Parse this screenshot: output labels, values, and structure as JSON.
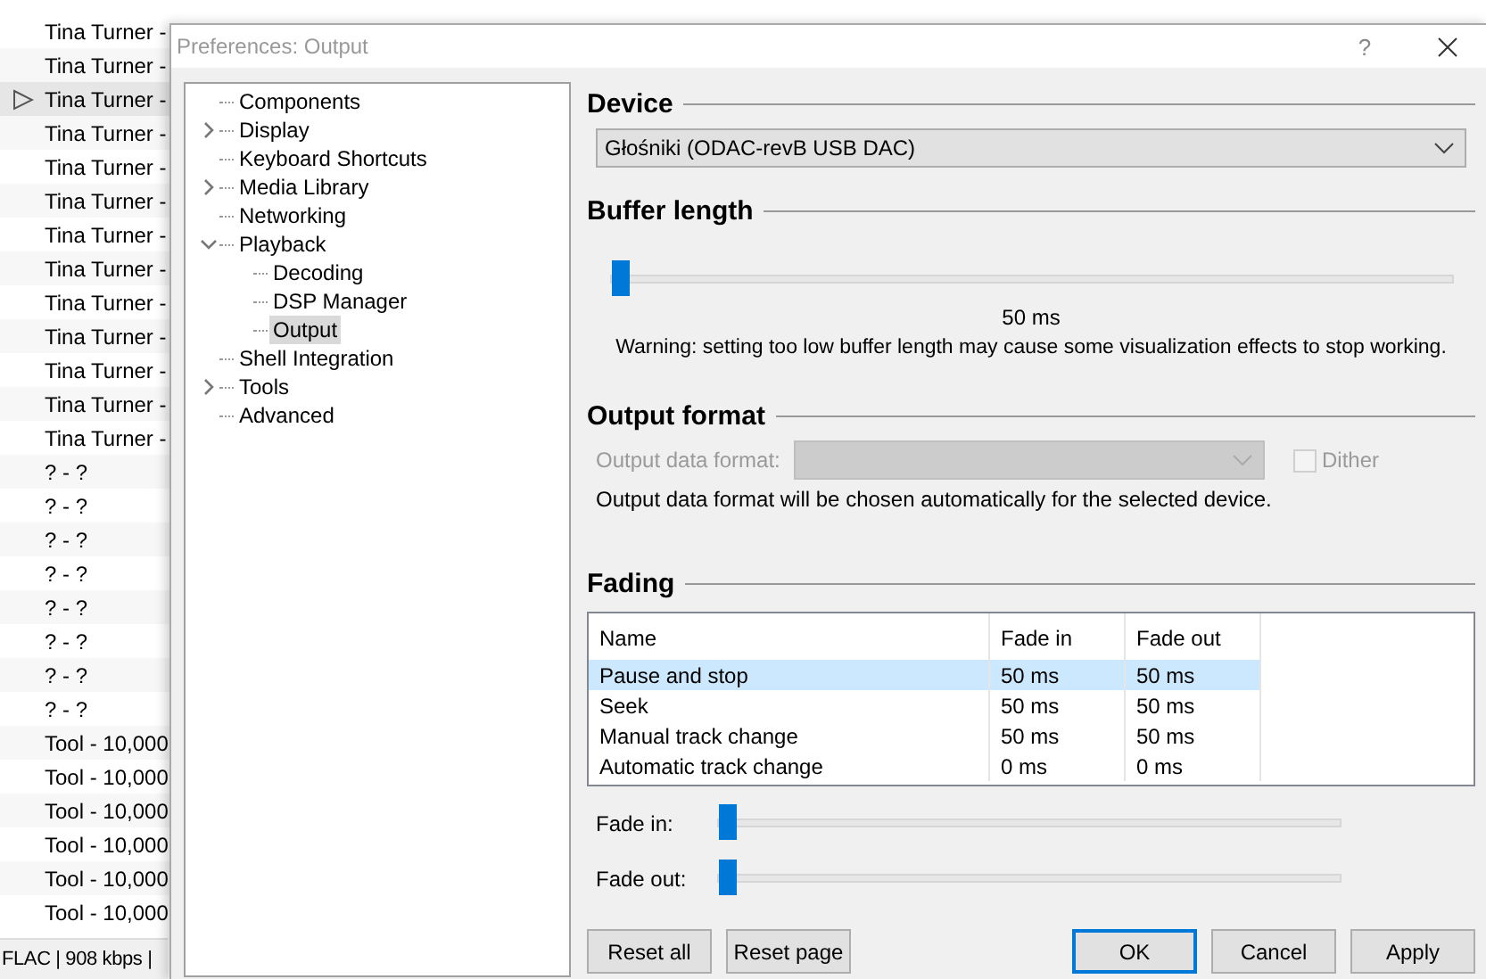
{
  "playlist": {
    "rows": [
      {
        "text": "Tina Turner -",
        "playing": false,
        "selected": false
      },
      {
        "text": "Tina Turner -",
        "playing": false,
        "selected": false
      },
      {
        "text": "Tina Turner -",
        "playing": true,
        "selected": true
      },
      {
        "text": "Tina Turner -",
        "playing": false,
        "selected": false
      },
      {
        "text": "Tina Turner -",
        "playing": false,
        "selected": false
      },
      {
        "text": "Tina Turner -",
        "playing": false,
        "selected": false
      },
      {
        "text": "Tina Turner -",
        "playing": false,
        "selected": false
      },
      {
        "text": "Tina Turner -",
        "playing": false,
        "selected": false
      },
      {
        "text": "Tina Turner -",
        "playing": false,
        "selected": false
      },
      {
        "text": "Tina Turner -",
        "playing": false,
        "selected": false
      },
      {
        "text": "Tina Turner -",
        "playing": false,
        "selected": false
      },
      {
        "text": "Tina Turner -",
        "playing": false,
        "selected": false
      },
      {
        "text": "Tina Turner -",
        "playing": false,
        "selected": false
      },
      {
        "text": "? - ?",
        "playing": false,
        "selected": false
      },
      {
        "text": "? - ?",
        "playing": false,
        "selected": false
      },
      {
        "text": "? - ?",
        "playing": false,
        "selected": false
      },
      {
        "text": "? - ?",
        "playing": false,
        "selected": false
      },
      {
        "text": "? - ?",
        "playing": false,
        "selected": false
      },
      {
        "text": "? - ?",
        "playing": false,
        "selected": false
      },
      {
        "text": "? - ?",
        "playing": false,
        "selected": false
      },
      {
        "text": "? - ?",
        "playing": false,
        "selected": false
      },
      {
        "text": "Tool - 10,000",
        "playing": false,
        "selected": false
      },
      {
        "text": "Tool - 10,000",
        "playing": false,
        "selected": false
      },
      {
        "text": "Tool - 10,000",
        "playing": false,
        "selected": false
      },
      {
        "text": "Tool - 10,000",
        "playing": false,
        "selected": false
      },
      {
        "text": "Tool - 10,000",
        "playing": false,
        "selected": false
      },
      {
        "text": "Tool - 10,000",
        "playing": false,
        "selected": false
      }
    ],
    "status_bar": "FLAC | 908 kbps |"
  },
  "dialog": {
    "title": "Preferences: Output",
    "help": "?",
    "tree": [
      {
        "label": "Components",
        "selected": false
      },
      {
        "label": "Display",
        "selected": false,
        "expanded": false
      },
      {
        "label": "Keyboard Shortcuts",
        "selected": false
      },
      {
        "label": "Media Library",
        "selected": false,
        "expanded": false
      },
      {
        "label": "Networking",
        "selected": false
      },
      {
        "label": "Playback",
        "selected": false,
        "expanded": true,
        "children": [
          {
            "label": "Decoding",
            "selected": false
          },
          {
            "label": "DSP Manager",
            "selected": false
          },
          {
            "label": "Output",
            "selected": true
          }
        ]
      },
      {
        "label": "Shell Integration",
        "selected": false
      },
      {
        "label": "Tools",
        "selected": false,
        "expanded": false
      },
      {
        "label": "Advanced",
        "selected": false
      }
    ],
    "device": {
      "heading": "Device",
      "value": "Głośniki (ODAC-revB USB DAC)"
    },
    "buffer": {
      "heading": "Buffer length",
      "level": 0,
      "reading": "50 ms",
      "warning": "Warning: setting too low buffer length may cause some visualization effects to stop working."
    },
    "output_format": {
      "heading": "Output format",
      "label": "Output data format:",
      "disabled": true,
      "dither": {
        "label": "Dither",
        "checked": false,
        "disabled": true
      },
      "note": "Output data format will be chosen automatically for the selected device."
    },
    "fading": {
      "heading": "Fading",
      "table": {
        "columns": [
          "Name",
          "Fade in",
          "Fade out"
        ],
        "rows": [
          {
            "cells": [
              "Pause and stop",
              "50 ms",
              "50 ms"
            ],
            "selected": true
          },
          {
            "cells": [
              "Seek",
              "50 ms",
              "50 ms"
            ],
            "selected": false
          },
          {
            "cells": [
              "Manual track change",
              "50 ms",
              "50 ms"
            ],
            "selected": false
          },
          {
            "cells": [
              "Automatic track change",
              "0 ms",
              "0 ms"
            ],
            "selected": false
          }
        ]
      },
      "sliders": [
        {
          "label": "Fade in:",
          "level": 0
        },
        {
          "label": "Fade out:",
          "level": 0
        }
      ]
    },
    "buttons_left": [
      "Reset all",
      "Reset page"
    ],
    "buttons_right": [
      {
        "label": "OK",
        "default": true
      },
      {
        "label": "Cancel",
        "default": false
      },
      {
        "label": "Apply",
        "default": false
      }
    ]
  }
}
